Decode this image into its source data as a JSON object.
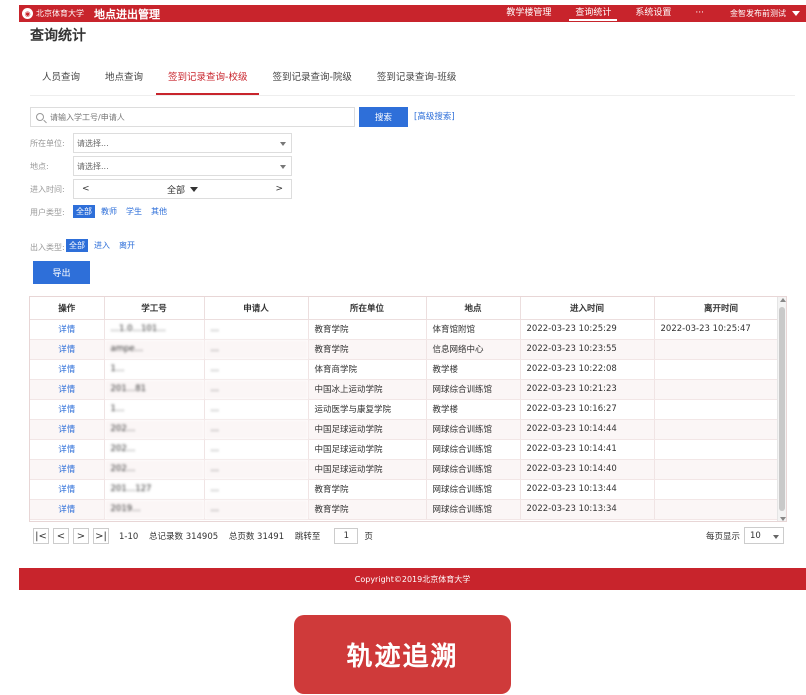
{
  "header": {
    "logo_text": "北京体育大学",
    "system_title": "地点进出管理",
    "nav": [
      "教学楼管理",
      "查询统计",
      "系统设置",
      "···"
    ],
    "active_nav": "查询统计",
    "user": "金智发布前测试"
  },
  "page_title": "查询统计",
  "tabs": [
    "人员查询",
    "地点查询",
    "签到记录查询-校级",
    "签到记录查询-院级",
    "签到记录查询-班级"
  ],
  "active_tab": "签到记录查询-校级",
  "search": {
    "placeholder": "请输入学工号/申请人",
    "button": "搜索",
    "advanced": "[高级搜索]"
  },
  "filters": {
    "unit_label": "所在单位:",
    "unit_value": "请选择...",
    "place_label": "地点:",
    "place_value": "请选择...",
    "time_label": "进入时间:",
    "time_prev": "<",
    "time_value": "全部",
    "time_next": ">",
    "user_type_label": "用户类型:",
    "user_types": [
      "全部",
      "教师",
      "学生",
      "其他"
    ],
    "io_type_label": "出入类型:",
    "io_types": [
      "全部",
      "进入",
      "离开"
    ]
  },
  "export_button": "导出",
  "table": {
    "columns": [
      "操作",
      "学工号",
      "申请人",
      "所在单位",
      "地点",
      "进入时间",
      "离开时间"
    ],
    "rows": [
      [
        "详情",
        "…1.0…101…",
        "…",
        "教育学院",
        "体育馆附馆",
        "2022-03-23 10:25:29",
        "2022-03-23 10:25:47"
      ],
      [
        "详情",
        "ampe…",
        "…",
        "教育学院",
        "信息网络中心",
        "2022-03-23 10:23:55",
        ""
      ],
      [
        "详情",
        "1…",
        "…",
        "体育商学院",
        "教学楼",
        "2022-03-23 10:22:08",
        ""
      ],
      [
        "详情",
        "201…81",
        "…",
        "中国冰上运动学院",
        "网球综合训练馆",
        "2022-03-23 10:21:23",
        ""
      ],
      [
        "详情",
        "1…",
        "…",
        "运动医学与康复学院",
        "教学楼",
        "2022-03-23 10:16:27",
        ""
      ],
      [
        "详情",
        "202…",
        "…",
        "中国足球运动学院",
        "网球综合训练馆",
        "2022-03-23 10:14:44",
        ""
      ],
      [
        "详情",
        "202…",
        "…",
        "中国足球运动学院",
        "网球综合训练馆",
        "2022-03-23 10:14:41",
        ""
      ],
      [
        "详情",
        "202…",
        "…",
        "中国足球运动学院",
        "网球综合训练馆",
        "2022-03-23 10:14:40",
        ""
      ],
      [
        "详情",
        "201…127",
        "…",
        "教育学院",
        "网球综合训练馆",
        "2022-03-23 10:13:44",
        ""
      ],
      [
        "详情",
        "2019…",
        "…",
        "教育学院",
        "网球综合训练馆",
        "2022-03-23 10:13:34",
        ""
      ]
    ]
  },
  "pagination": {
    "first": "|<",
    "prev": "<",
    "next": ">",
    "last": ">|",
    "range": "1-10",
    "total_label": "总记录数 314905",
    "pages_label": "总页数 31491",
    "goto_label": "跳转至",
    "current_page": "1",
    "page_unit": "页",
    "per_page_label": "每页显示",
    "per_page_value": "10"
  },
  "footer": "Copyright©2019北京体育大学",
  "trace_button": "轨迹追溯",
  "colors": {
    "brand_red": "#c8242c",
    "primary_blue": "#2e6fd9",
    "trace_button_red": "#cf3a3a"
  }
}
